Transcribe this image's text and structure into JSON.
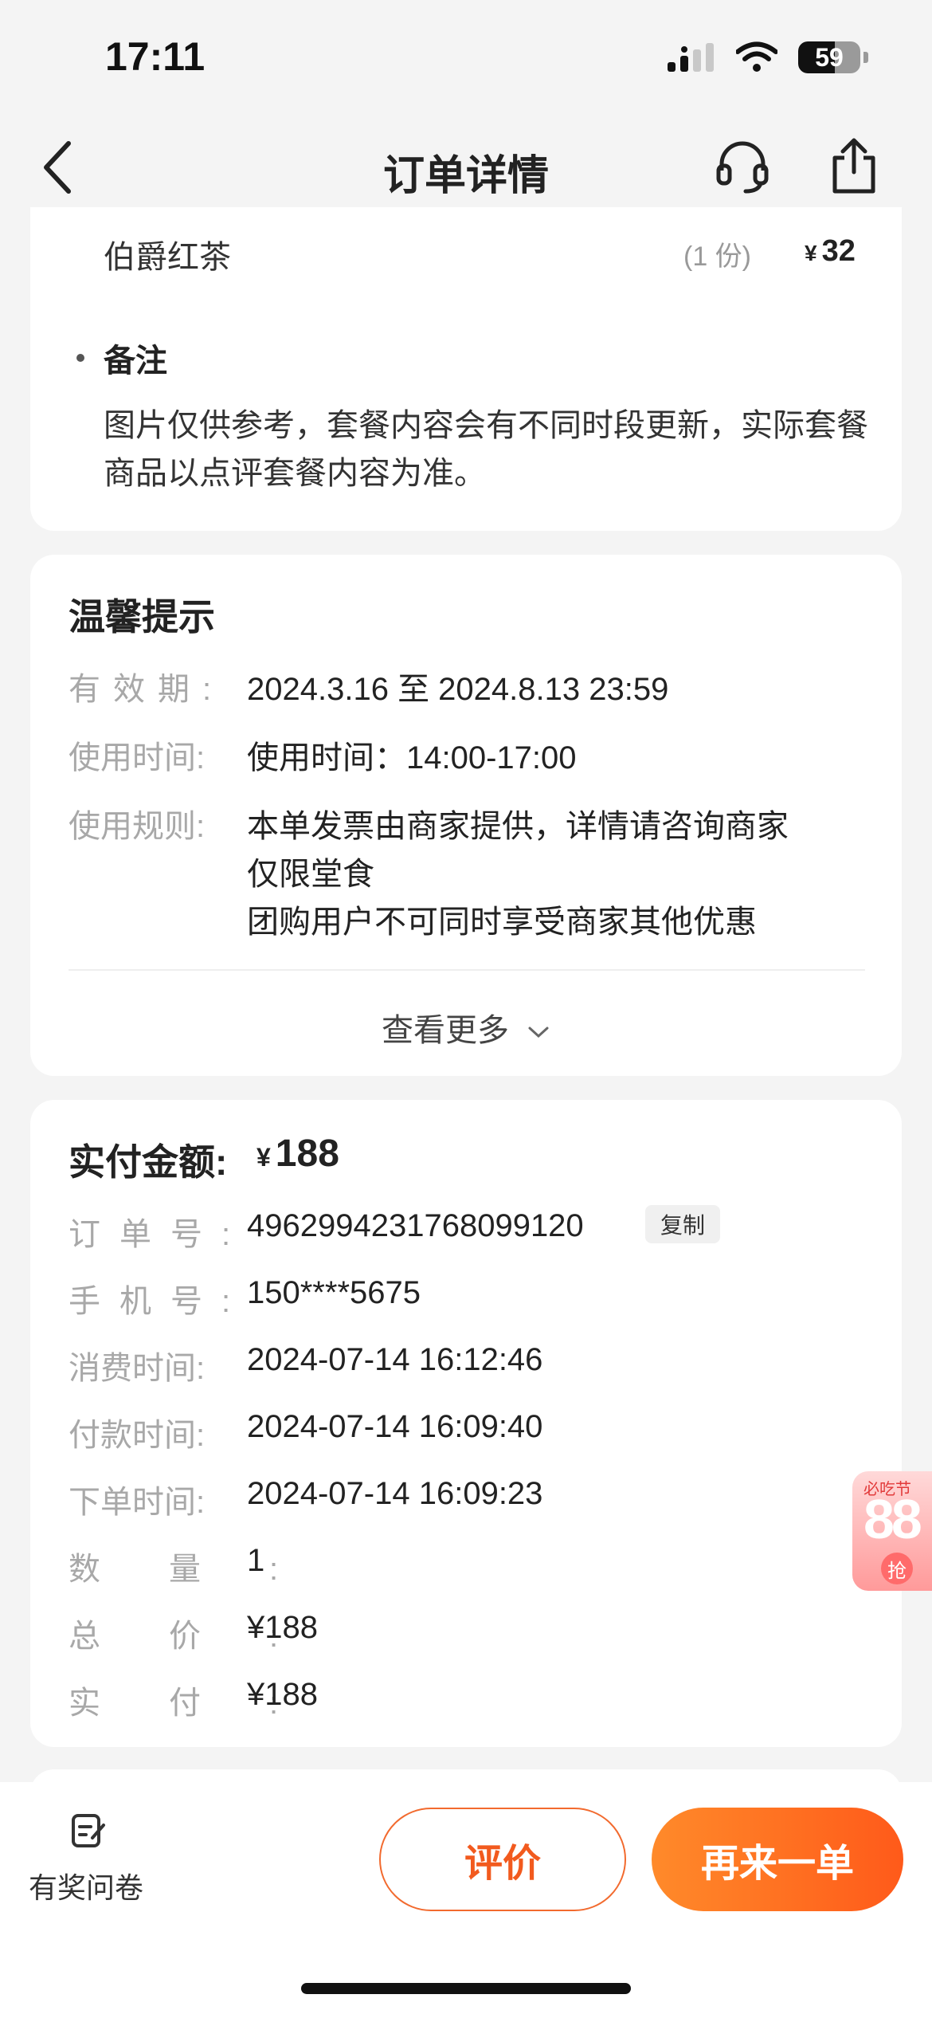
{
  "status": {
    "time": "17:11",
    "battery": "59",
    "battery_level": 0.59
  },
  "nav": {
    "title": "订单详情",
    "back_icon": "chevron-left-icon",
    "headset_icon": "headset-icon",
    "share_icon": "share-icon"
  },
  "item": {
    "name": "伯爵红茶",
    "qty": "(1 份)",
    "currency": "¥",
    "price": "32"
  },
  "note": {
    "title": "备注",
    "text": "图片仅供参考，套餐内容会有不同时段更新，实际套餐商品以点评套餐内容为准。"
  },
  "tips": {
    "title": "温馨提示",
    "validity": {
      "label": "有效期:",
      "value": "2024.3.16 至 2024.8.13 23:59"
    },
    "usage_time": {
      "label": "使用时间:",
      "value": "使用时间：14:00-17:00"
    },
    "rules": {
      "label": "使用规则:",
      "lines": [
        "本单发票由商家提供，详情请咨询商家",
        "仅限堂食",
        "团购用户不可同时享受商家其他优惠"
      ]
    },
    "more": "查看更多"
  },
  "payment": {
    "title": "实付金额:",
    "currency": "¥",
    "amount": "188",
    "order_no": {
      "label": "订单号:",
      "value": "4962994231768099120",
      "copy": "复制"
    },
    "phone": {
      "label": "手机号:",
      "value": "150****5675"
    },
    "consume_time": {
      "label": "消费时间:",
      "value": "2024-07-14 16:12:46"
    },
    "pay_time": {
      "label": "付款时间:",
      "value": "2024-07-14 16:09:40"
    },
    "order_time": {
      "label": "下单时间:",
      "value": "2024-07-14 16:09:23"
    },
    "quantity": {
      "label": "数量:",
      "value": "1"
    },
    "total": {
      "label": "总价:",
      "value": "¥188"
    },
    "paid": {
      "label": "实付:",
      "value": "¥188"
    }
  },
  "promo": {
    "small": "必吃节",
    "big": "88",
    "badge": "抢"
  },
  "bottom": {
    "survey_label": "有奖问卷",
    "review": "评价",
    "reorder": "再来一单"
  },
  "colors": {
    "accent": "#ff5a1a",
    "label_gray": "#a8a8a8"
  }
}
